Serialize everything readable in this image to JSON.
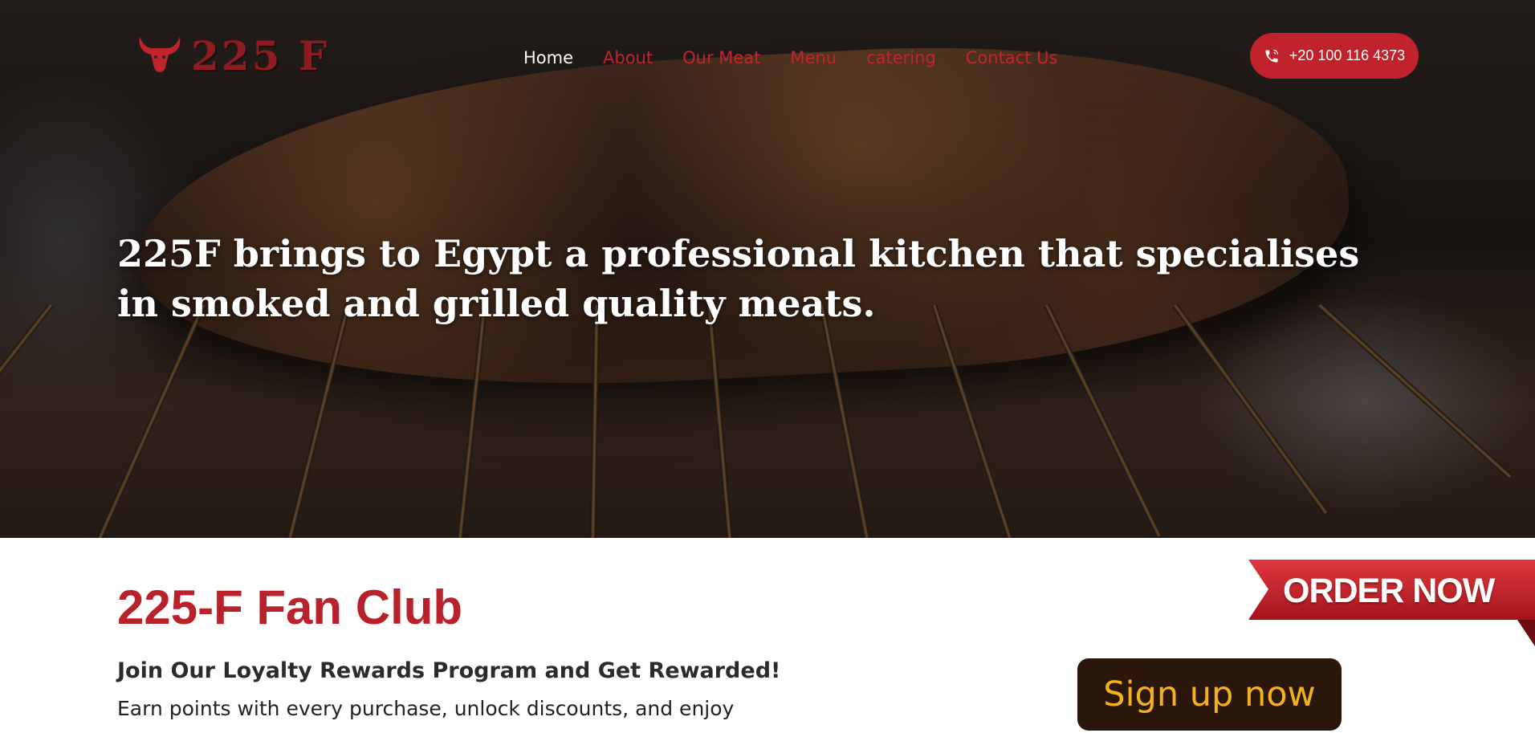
{
  "header": {
    "logo_text": "225 F",
    "nav": [
      {
        "label": "Home",
        "active": true
      },
      {
        "label": "About",
        "active": false
      },
      {
        "label": "Our Meat",
        "active": false
      },
      {
        "label": "Menu",
        "active": false
      },
      {
        "label": "catering",
        "active": false
      },
      {
        "label": "Contact Us",
        "active": false
      }
    ],
    "phone": "+20 100 116 4373"
  },
  "hero": {
    "headline": "225F brings to Egypt a professional kitchen that specialises in smoked and grilled quality meats."
  },
  "fan_club": {
    "title": "225-F Fan Club",
    "heading": "Join Our Loyalty Rewards Program and Get Rewarded!",
    "text": "Earn points with every purchase, unlock discounts, and enjoy",
    "signup_label": "Sign up now"
  },
  "order_now": {
    "label": "ORDER NOW"
  },
  "colors": {
    "brand_red": "#c0232c",
    "signup_bg": "#2b160c",
    "signup_text": "#f3b21b"
  }
}
